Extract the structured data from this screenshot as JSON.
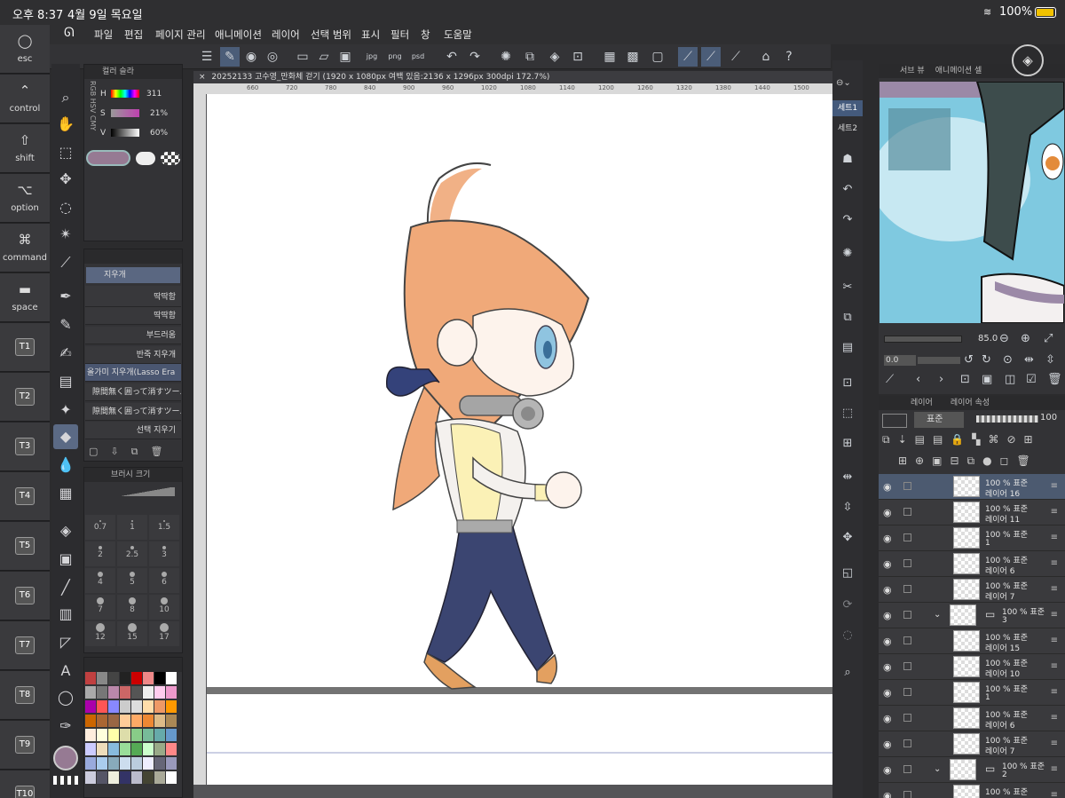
{
  "status": {
    "time": "오후 8:37",
    "date": "4월 9일 목요일",
    "battery": "100%"
  },
  "keys": [
    {
      "sym": "◯",
      "label": "esc"
    },
    {
      "sym": "⌃",
      "label": "control"
    },
    {
      "sym": "⇧",
      "label": "shift"
    },
    {
      "sym": "⌥",
      "label": "option"
    },
    {
      "sym": "⌘",
      "label": "command"
    },
    {
      "sym": "▬",
      "label": "space"
    },
    {
      "label": "T1"
    },
    {
      "label": "T2"
    },
    {
      "label": "T3"
    },
    {
      "label": "T4"
    },
    {
      "label": "T5"
    },
    {
      "label": "T6"
    },
    {
      "label": "T7"
    },
    {
      "label": "T8"
    },
    {
      "label": "T9"
    },
    {
      "label": "T10"
    }
  ],
  "menu": [
    "파일",
    "편집",
    "페이지 관리",
    "애니메이션",
    "레이어",
    "선택 범위",
    "표시",
    "필터",
    "창",
    "도움말"
  ],
  "color": {
    "panel_tab": "컬러 슬라",
    "modes": "RGB HSV CMY",
    "h_label": "H",
    "h_value": "311",
    "s_label": "S",
    "s_value": "21%",
    "v_label": "V",
    "v_value": "60%",
    "main_color": "#967a93"
  },
  "subtool": {
    "group": "지우개",
    "items": [
      "딱딱함",
      "딱딱함",
      "부드러움",
      "반죽 지우개",
      "올가미 지우개(Lasso Era",
      "隙間無く囲って消すツール",
      "隙間無く囲って消すツール",
      "선택 지우기"
    ]
  },
  "brushsize": {
    "title": "브러시 크기",
    "sizes": [
      "0.7",
      "1",
      "1.5",
      "2",
      "2.5",
      "3",
      "4",
      "5",
      "6",
      "7",
      "8",
      "10",
      "12",
      "15",
      "17"
    ]
  },
  "doc": {
    "title": "20252133 고수영_만화체 걷기 (1920 x 1080px 여백 있음:2136 x 1296px 300dpi 172.7%)"
  },
  "ruler_marks": [
    "660",
    "720",
    "780",
    "840",
    "900",
    "960",
    "1020",
    "1080",
    "1140",
    "1200",
    "1260",
    "1320",
    "1380",
    "1440",
    "1500"
  ],
  "sets": [
    "세트1",
    "세트2"
  ],
  "subview": {
    "tab1": "서브 뷰",
    "tab2": "애니메이션 셀",
    "zoom": "85.0",
    "rotate": "0.0"
  },
  "layer_panel": {
    "tab1": "레이어",
    "tab2": "레이어 속성",
    "blend": "표준",
    "opacity": "100"
  },
  "layers": [
    {
      "pct": "100 % 표준",
      "name": "레이어 16",
      "selected": true
    },
    {
      "pct": "100 % 표준",
      "name": "레이어 11"
    },
    {
      "pct": "100 % 표준",
      "name": "1"
    },
    {
      "pct": "100 % 표준",
      "name": "레이어 6"
    },
    {
      "pct": "100 % 표준",
      "name": "레이어 7"
    },
    {
      "pct": "100 % 표준",
      "name": "3",
      "folder": true
    },
    {
      "pct": "100 % 표준",
      "name": "레이어 15"
    },
    {
      "pct": "100 % 표준",
      "name": "레이어 10"
    },
    {
      "pct": "100 % 표준",
      "name": "1"
    },
    {
      "pct": "100 % 표준",
      "name": "레이어 6"
    },
    {
      "pct": "100 % 표준",
      "name": "레이어 7"
    },
    {
      "pct": "100 % 표준",
      "name": "2",
      "folder": true
    },
    {
      "pct": "100 % 표준",
      "name": ""
    }
  ]
}
